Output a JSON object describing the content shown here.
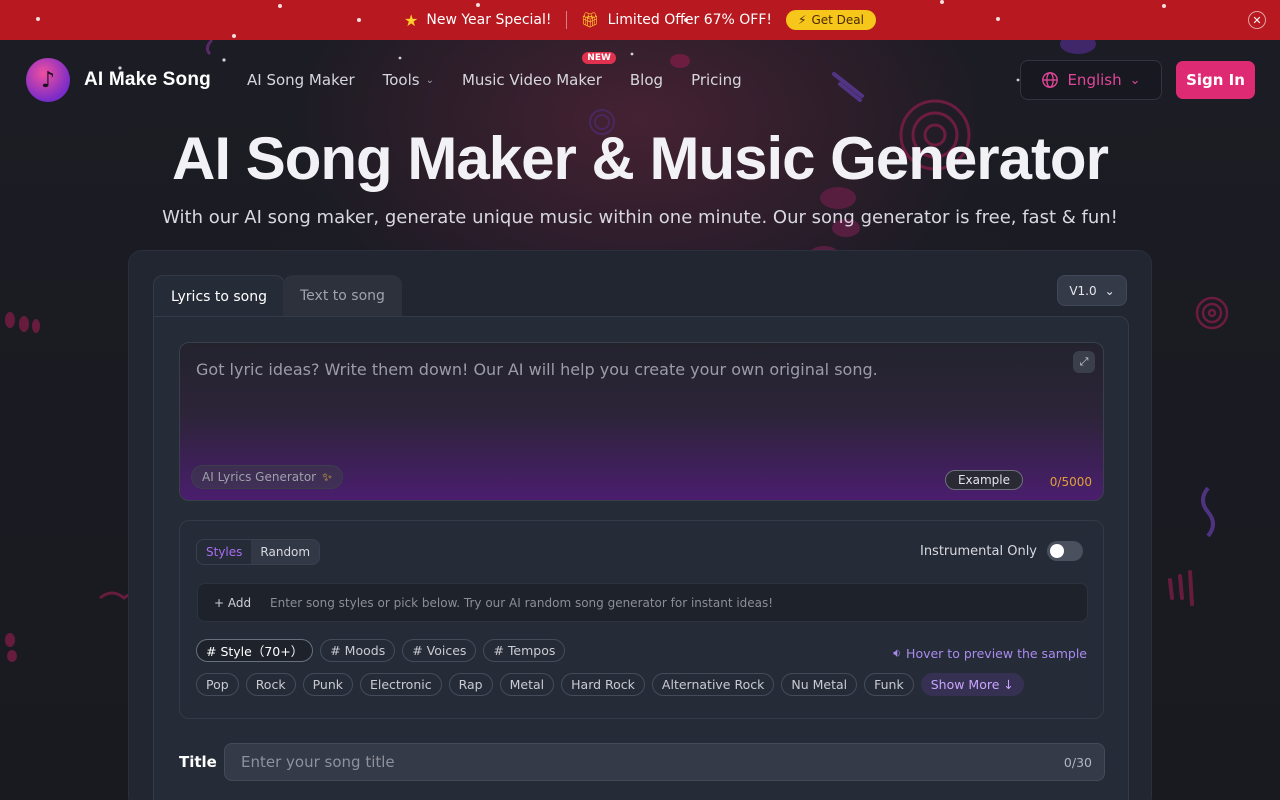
{
  "promo": {
    "special_label": "New Year Special!",
    "special_icon": "star-icon",
    "offer_label": "Limited Offer 67% OFF!",
    "offer_icon": "gift-icon",
    "deal_button": "Get Deal",
    "deal_icon": "lightning-icon",
    "close_icon": "close-icon",
    "bg_color": "#b8181f"
  },
  "nav": {
    "brand": "AI Make Song",
    "items": [
      {
        "label": "AI Song Maker"
      },
      {
        "label": "Tools",
        "has_dropdown": true
      },
      {
        "label": "Music Video Maker",
        "badge": "NEW"
      },
      {
        "label": "Blog"
      },
      {
        "label": "Pricing"
      }
    ],
    "language": "English",
    "sign_in": "Sign In",
    "accent": "#dd2a73"
  },
  "hero": {
    "title": "AI Song Maker & Music Generator",
    "subtitle": "With our AI song maker, generate unique music within one minute. Our song generator is free, fast & fun!"
  },
  "card": {
    "tabs": [
      {
        "label": "Lyrics to song",
        "active": true
      },
      {
        "label": "Text to song",
        "active": false
      }
    ],
    "version": "V1.0",
    "lyrics": {
      "placeholder": "Got lyric ideas? Write them down! Our AI will help you create your own original song.",
      "ai_generator": "AI Lyrics Generator",
      "example": "Example",
      "count": "0/5000"
    },
    "styles": {
      "segment": [
        "Styles",
        "Random"
      ],
      "instrumental_label": "Instrumental Only",
      "instrumental_on": false,
      "add_label": "+ Add",
      "input_placeholder": "Enter song styles or pick below. Try our AI random song generator for instant ideas!",
      "categories": [
        "# Style（70+）",
        "# Moods",
        "# Voices",
        "# Tempos"
      ],
      "hover_note": "Hover to preview the sample",
      "chips": [
        "Pop",
        "Rock",
        "Punk",
        "Electronic",
        "Rap",
        "Metal",
        "Hard Rock",
        "Alternative Rock",
        "Nu Metal",
        "Funk"
      ],
      "show_more": "Show More ↓"
    },
    "title_field": {
      "label": "Title",
      "placeholder": "Enter your song title",
      "count": "0/30"
    }
  }
}
